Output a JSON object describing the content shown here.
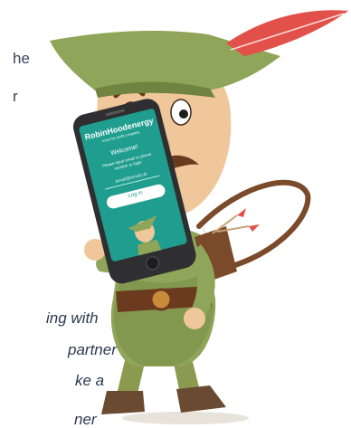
{
  "background_text": {
    "top_fragments": [
      "he",
      "r"
    ],
    "bottom_fragments": [
      "ing with",
      "partner",
      "ke a",
      "ner"
    ]
  },
  "phone": {
    "brand_name": "RobinHoodenergy",
    "brand_tagline": "more for profit company",
    "welcome": "Welcome!",
    "prompt_line1": "Please input email or phone",
    "prompt_line2": "number to login",
    "email_placeholder": "email@email.uk",
    "login_button": "Log in",
    "screen_color": "#1f9d8e"
  },
  "colors": {
    "hat": "#8fa559",
    "hat_band": "#6e8440",
    "feather": "#e2504a",
    "skin": "#f0c79a",
    "tunic": "#8fa559",
    "belt": "#6b3a1f",
    "bow": "#7a4a2a",
    "phone_body": "#2f2f32"
  }
}
